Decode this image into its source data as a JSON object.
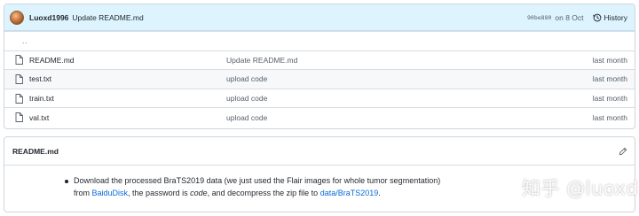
{
  "commit": {
    "author": "Luoxd1996",
    "message": "Update README.md",
    "sha": "90be880",
    "date": "on 8 Oct",
    "history_label": "History"
  },
  "parent_link": "..",
  "files": [
    {
      "name": "README.md",
      "message": "Update README.md",
      "age": "last month",
      "icon": "file-icon"
    },
    {
      "name": "test.txt",
      "message": "upload code",
      "age": "last month",
      "icon": "file-icon"
    },
    {
      "name": "train.txt",
      "message": "upload code",
      "age": "last month",
      "icon": "file-icon"
    },
    {
      "name": "val.txt",
      "message": "upload code",
      "age": "last month",
      "icon": "file-icon"
    }
  ],
  "readme": {
    "title": "README.md",
    "text_1": "Download the processed BraTS2019 data (we just used the Flair images for whole tumor segmentation) from ",
    "link_1": "BaiduDisk",
    "text_2": ", the password is ",
    "em": "code",
    "text_3": ", and decompress the zip file to ",
    "link_2": "data/BraTS2019",
    "text_4": "."
  },
  "watermark": "知乎 @luoxd",
  "colors": {
    "commit_bar_bg": "#ddf4ff",
    "link": "#0969da",
    "muted": "#57606a",
    "border": "#d0d7de"
  }
}
